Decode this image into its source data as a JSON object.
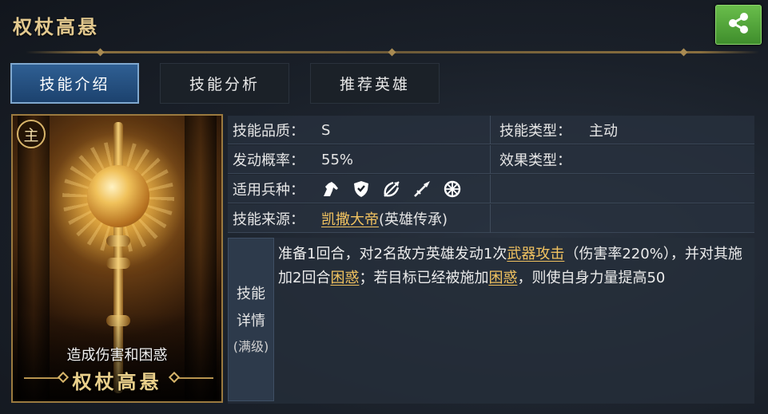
{
  "header": {
    "title": "权杖高悬",
    "share_icon": "share-icon",
    "share_color": "#4ea637"
  },
  "tabs": [
    {
      "label": "技能介绍",
      "active": true
    },
    {
      "label": "技能分析",
      "active": false
    },
    {
      "label": "推荐英雄",
      "active": false
    }
  ],
  "card": {
    "badge": "主",
    "effect": "造成伤害和困惑",
    "name": "权杖高悬"
  },
  "info": {
    "quality_label": "技能品质：",
    "quality_value": "S",
    "type_label": "技能类型：",
    "type_value": "主动",
    "rate_label": "发动概率：",
    "rate_value": "55%",
    "effect_type_label": "效果类型：",
    "effect_type_value": "",
    "troops_label": "适用兵种：",
    "troops": [
      "cavalry-icon",
      "shield-icon",
      "archer-icon",
      "spear-icon",
      "siege-wheel-icon"
    ],
    "source_label": "技能来源：",
    "source_link": "凯撒大帝",
    "source_suffix": "(英雄传承)"
  },
  "detail": {
    "label_line1": "技能",
    "label_line2": "详情",
    "label_line3": "(满级)",
    "t1": "准备1回合，对2名敌方英雄发动1次",
    "link1": "武器攻击",
    "t2": "（伤害率220%）",
    "t3": "，并对其施加2回合",
    "link2": "困惑",
    "t4": "；若目标已经被施加",
    "link3": "困惑",
    "t5": "，则使自身力量提高50"
  }
}
